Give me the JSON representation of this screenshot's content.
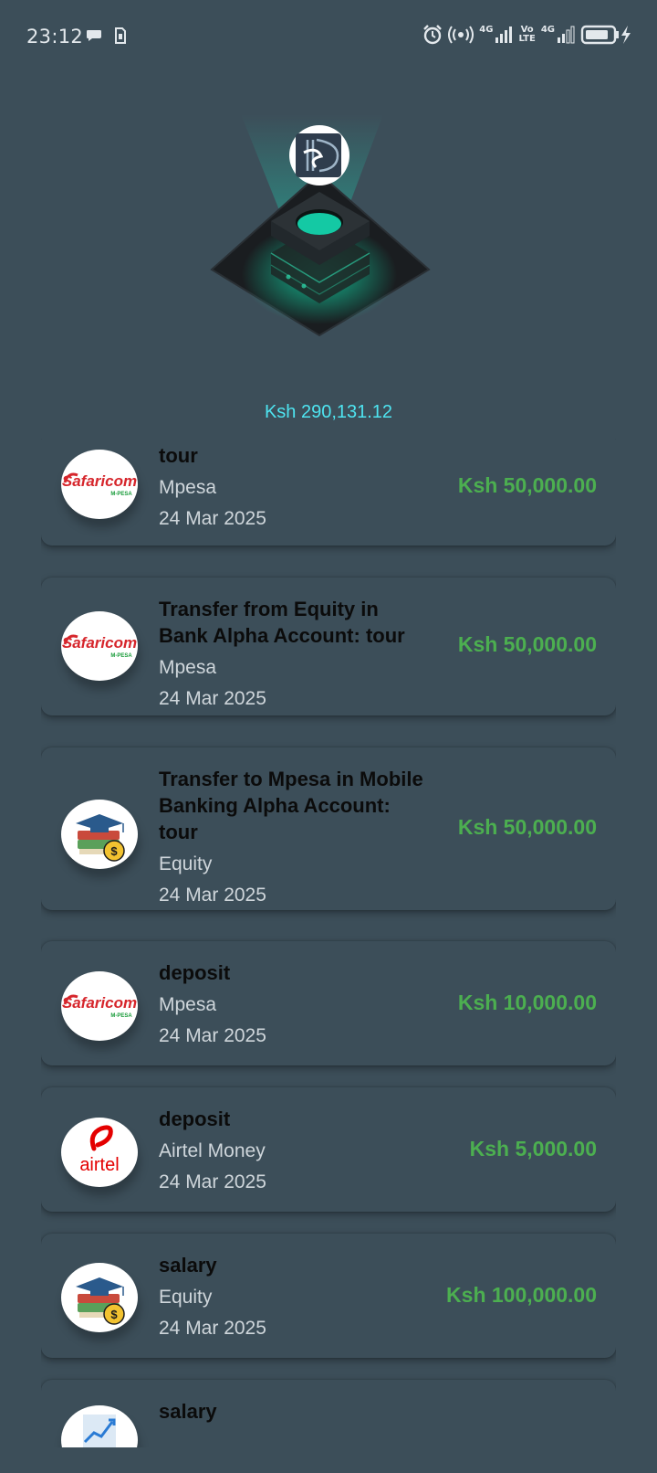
{
  "status_bar": {
    "time": "23:12",
    "left_icons": [
      "chat-bubble-icon",
      "sim-card-icon"
    ],
    "right_icons": [
      "alarm-icon",
      "hotspot-icon",
      "signal-4g-icon",
      "volte-icon",
      "signal-4g-icon-2",
      "battery-charging-icon"
    ],
    "signal1_label": "4G",
    "volte_label_top": "Vo",
    "volte_label_bottom": "LTE",
    "signal2_label": "4G"
  },
  "balance": "Ksh 290,131.12",
  "colors": {
    "background": "#3c4e59",
    "amount": "#4caf50",
    "balance": "#4ee4f0",
    "title": "#0b0b0b",
    "subtext": "#cfd6db"
  },
  "transactions": [
    {
      "title": "tour",
      "provider": "Mpesa",
      "date": "24 Mar 2025",
      "amount": "Ksh 50,000.00",
      "logo": "safaricom-logo"
    },
    {
      "title": "Transfer from Equity  in Bank Alpha Account: tour",
      "provider": "Mpesa",
      "date": "24 Mar 2025",
      "amount": "Ksh 50,000.00",
      "logo": "safaricom-logo"
    },
    {
      "title": "Transfer to Mpesa in Mobile Banking  Alpha Account: tour",
      "provider": "Equity",
      "date": "24 Mar 2025",
      "amount": "Ksh 50,000.00",
      "logo": "equity-logo"
    },
    {
      "title": "deposit",
      "provider": "Mpesa",
      "date": "24 Mar 2025",
      "amount": "Ksh 10,000.00",
      "logo": "safaricom-logo"
    },
    {
      "title": "deposit",
      "provider": "Airtel Money",
      "date": "24 Mar 2025",
      "amount": "Ksh 5,000.00",
      "logo": "airtel-logo"
    },
    {
      "title": "salary",
      "provider": "Equity",
      "date": "24 Mar 2025",
      "amount": "Ksh 100,000.00",
      "logo": "equity-logo"
    },
    {
      "title": "salary",
      "provider": "",
      "date": "",
      "amount": "",
      "logo": "investment-chart-logo"
    }
  ],
  "logo_texts": {
    "safaricom": "Safaricom",
    "mpesa": "M-PESA",
    "airtel": "airtel"
  }
}
